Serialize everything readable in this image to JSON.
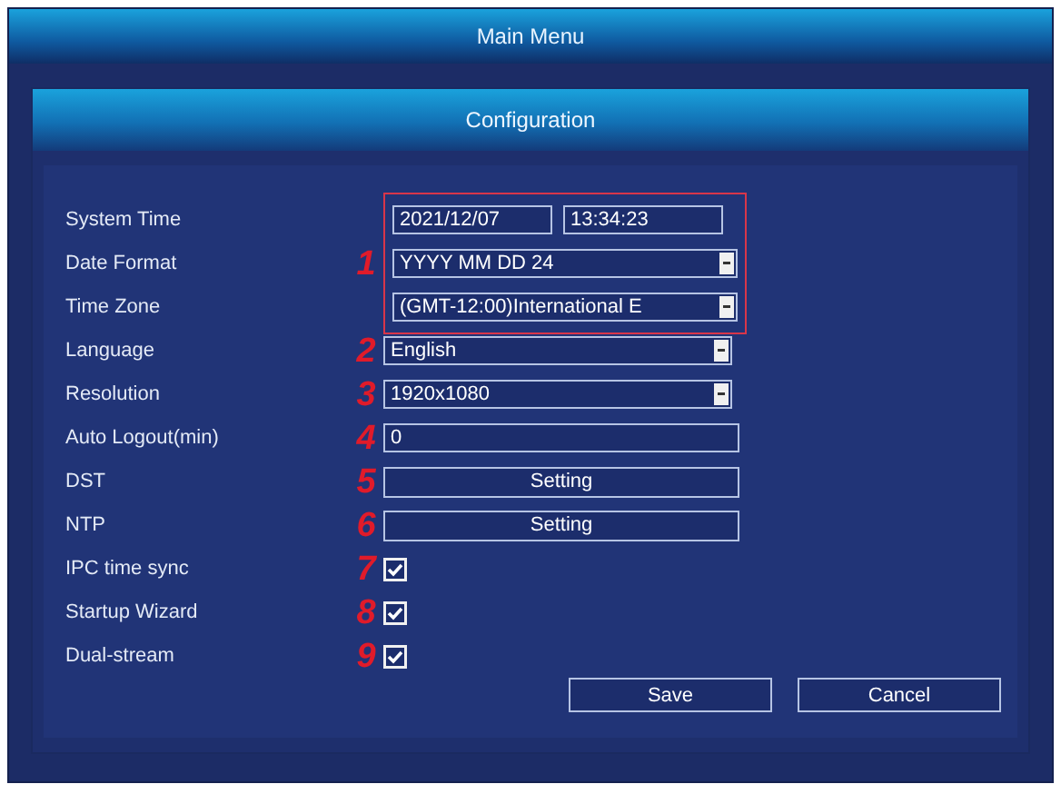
{
  "window": {
    "title": "Main Menu"
  },
  "panel": {
    "title": "Configuration"
  },
  "annotated_group": {
    "marker": "1",
    "rows": [
      {
        "label": "System Time",
        "kind": "datetime",
        "date": "2021/12/07",
        "time": "13:34:23"
      },
      {
        "label": "Date Format",
        "kind": "select",
        "value": "YYYY MM DD 24"
      },
      {
        "label": "Time Zone",
        "kind": "select",
        "value": "(GMT-12:00)International E"
      }
    ]
  },
  "rows": [
    {
      "label": "Language",
      "marker": "2",
      "kind": "select",
      "value": "English"
    },
    {
      "label": "Resolution",
      "marker": "3",
      "kind": "select",
      "value": "1920x1080"
    },
    {
      "label": "Auto Logout(min)",
      "marker": "4",
      "kind": "input",
      "value": "0"
    },
    {
      "label": "DST",
      "marker": "5",
      "kind": "button",
      "value": "Setting"
    },
    {
      "label": "NTP",
      "marker": "6",
      "kind": "button",
      "value": "Setting"
    },
    {
      "label": "IPC time sync",
      "marker": "7",
      "kind": "checkbox",
      "checked": true
    },
    {
      "label": "Startup Wizard",
      "marker": "8",
      "kind": "checkbox",
      "checked": true
    },
    {
      "label": "Dual-stream",
      "marker": "9",
      "kind": "checkbox",
      "checked": true
    }
  ],
  "buttons": [
    "Save",
    "Cancel"
  ]
}
